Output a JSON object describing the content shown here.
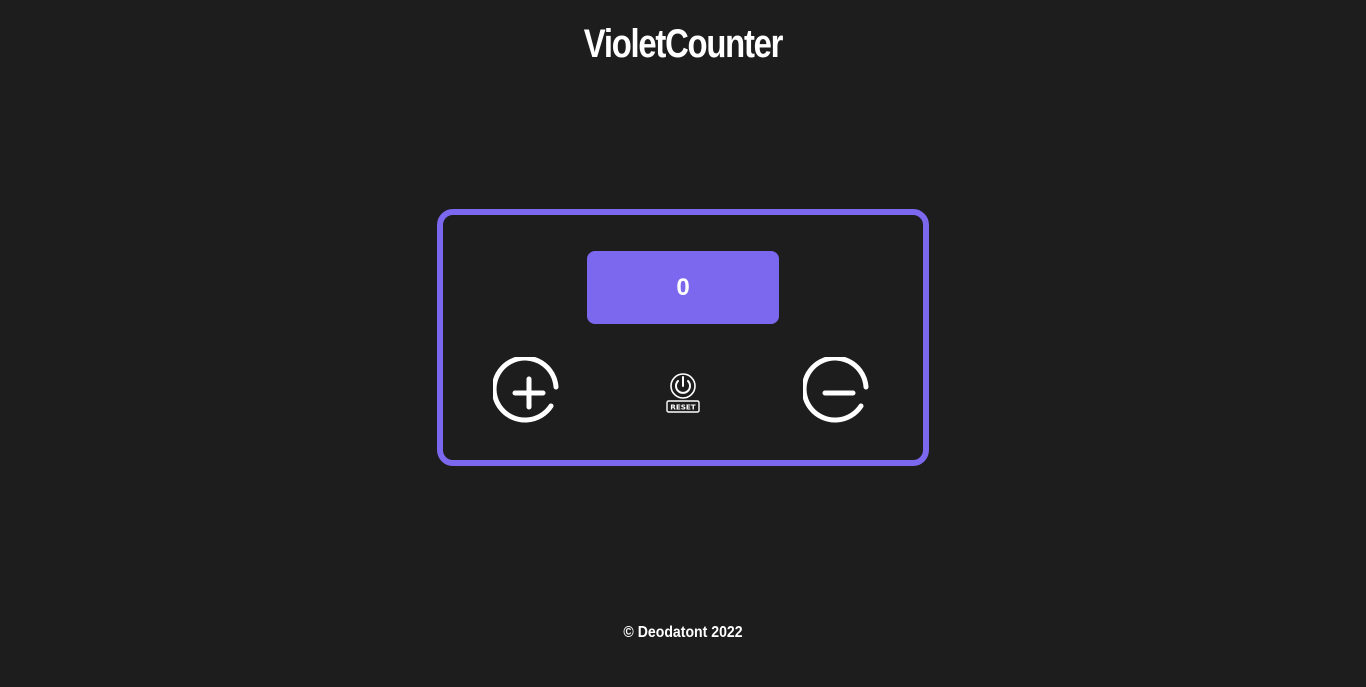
{
  "header": {
    "title": "VioletCounter"
  },
  "counter": {
    "value": "0",
    "increment_icon": "plus-circle-icon",
    "decrement_icon": "minus-circle-icon",
    "reset_icon": "power-reset-icon",
    "reset_label": "RESET"
  },
  "footer": {
    "copyright": "© Deodatont 2022"
  },
  "colors": {
    "background": "#1d1d1d",
    "accent": "#7b68ee",
    "text": "#ffffff"
  }
}
